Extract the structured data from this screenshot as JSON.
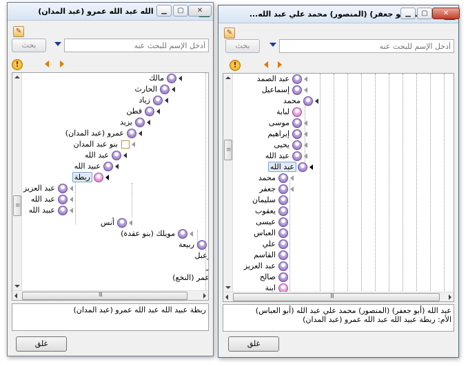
{
  "back_window": {
    "title": "ربطة عبيد الله عبد الله عمرو (عبد المدان)",
    "search_button": "بحث",
    "search_placeholder": "أدخل الإسم للبحث عنه",
    "tree": [
      {
        "label": "مالك",
        "gender": "male"
      },
      {
        "label": "الحارث",
        "gender": "male"
      },
      {
        "label": "زياد",
        "gender": "male"
      },
      {
        "label": "قطن",
        "gender": "male"
      },
      {
        "label": "يزيد",
        "gender": "male"
      },
      {
        "label": "عمرو (عبد المدان)",
        "gender": "male"
      },
      {
        "label": "بنو عبد المدان",
        "gender": "group"
      },
      {
        "label": "عبد الله",
        "gender": "male"
      },
      {
        "label": "عبيد الله",
        "gender": "male"
      },
      {
        "label": "ربطة",
        "gender": "female"
      },
      {
        "label": "عبد العزيز",
        "gender": "male"
      },
      {
        "label": "عبد الله",
        "gender": "male"
      },
      {
        "label": "عبيد الله",
        "gender": "male"
      },
      {
        "label": "أنس",
        "gender": "male"
      },
      {
        "label": "مويلك (بنو عقدة)",
        "gender": "male"
      },
      {
        "label": "ربيعة",
        "gender": "male"
      },
      {
        "label": "زعبل",
        "gender": "none"
      },
      {
        "label": "عر",
        "gender": "none"
      },
      {
        "label": "عمر (النخع)",
        "gender": "none"
      }
    ],
    "info_text": "ربطة عبيد الله عبد الله عمرو (عبد المدان)",
    "close_button": "غلق"
  },
  "front_window": {
    "title": "عبد الله (أبو جعفر) (المنصور)  محمد علي عبد الله...",
    "search_button": "بحث",
    "search_placeholder": "أدخل الإسم للبحث عنه",
    "tree": [
      {
        "label": "عبد الصمد",
        "gender": "male"
      },
      {
        "label": "إسماعيل",
        "gender": "male"
      },
      {
        "label": "محمد",
        "gender": "male"
      },
      {
        "label": "لبابة",
        "gender": "female"
      },
      {
        "label": "موسى",
        "gender": "male"
      },
      {
        "label": "إبراهيم",
        "gender": "male"
      },
      {
        "label": "يحيى",
        "gender": "male"
      },
      {
        "label": "عبد الله",
        "gender": "male"
      },
      {
        "label": "عبد الله",
        "gender": "male"
      },
      {
        "label": "محمد",
        "gender": "male"
      },
      {
        "label": "جعفر",
        "gender": "male"
      },
      {
        "label": "سليمان",
        "gender": "male"
      },
      {
        "label": "يعقوب",
        "gender": "male"
      },
      {
        "label": "عيسى",
        "gender": "male"
      },
      {
        "label": "العباس",
        "gender": "male"
      },
      {
        "label": "علي",
        "gender": "male"
      },
      {
        "label": "القاسم",
        "gender": "male"
      },
      {
        "label": "عبد العزيز",
        "gender": "male"
      },
      {
        "label": "صالح",
        "gender": "male"
      },
      {
        "label": "ابنة",
        "gender": "female"
      }
    ],
    "info_line1": "عبد الله (أبو جعفر) (المنصور)  محمد علي عبد الله (أبو العباس)",
    "info_line2": "الأم: ربطة عبيد الله عبد الله عمرو (عبد المدان)",
    "close_button": "غلق"
  },
  "icons": {
    "app": "green-check-icon",
    "tool": "edit-icon",
    "warning": "warning-icon",
    "male": "male-person-icon",
    "female": "female-person-icon"
  },
  "colors": {
    "title_gradient_top": "#eef4fb",
    "close_red": "#c4402a",
    "selection": "#dfeaf7",
    "male": "#7e5fb0",
    "female": "#d060c0",
    "nav_arrow": "#e07a00"
  }
}
